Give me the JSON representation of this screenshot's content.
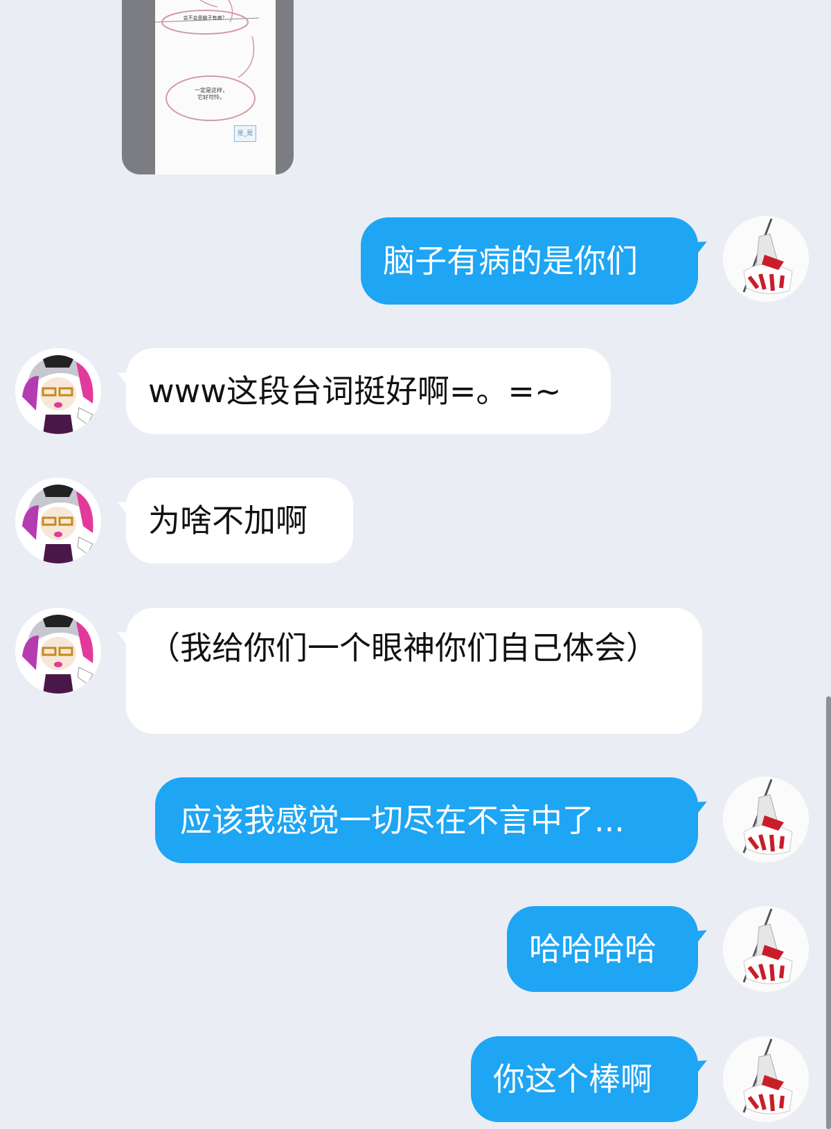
{
  "shared_image": {
    "question": "会不会是脑子有病？",
    "answer_line1": "一定是这样，",
    "answer_line2": "它好可怜。",
    "button": "是_是"
  },
  "messages": [
    {
      "side": "out",
      "text": "脑子有病的是你们"
    },
    {
      "side": "in",
      "text": "www这段台词挺好啊=。=~"
    },
    {
      "side": "in",
      "text": "为啥不加啊"
    },
    {
      "side": "in",
      "text": "（我给你们一个眼神你们自己体会）"
    },
    {
      "side": "out",
      "text": "应该我感觉一切尽在不言中了..."
    },
    {
      "side": "out",
      "text": "哈哈哈哈"
    },
    {
      "side": "out",
      "text": "你这个棒啊"
    }
  ],
  "colors": {
    "background": "#eaedf4",
    "outgoing_bubble": "#1ea5f3",
    "incoming_bubble": "#ffffff"
  },
  "icons": {
    "self_avatar": "white-red-spear-figure-avatar-icon",
    "peer_avatar": "pink-haired-cartoon-girl-avatar-icon"
  }
}
